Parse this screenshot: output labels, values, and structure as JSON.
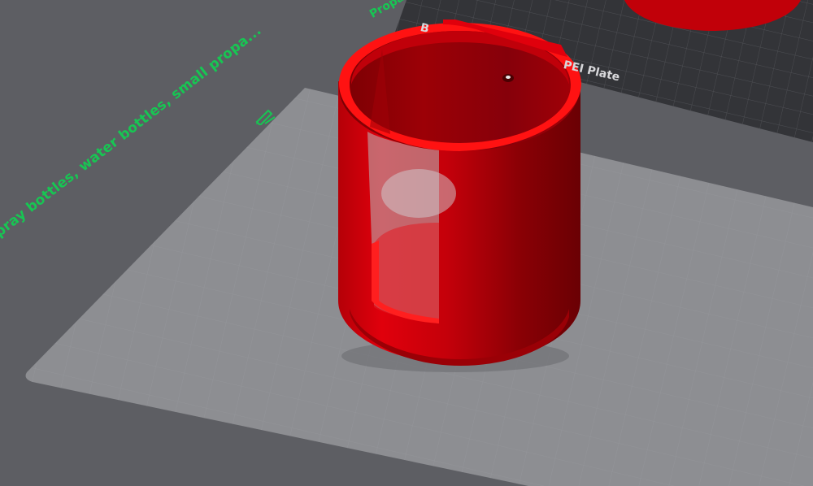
{
  "viewport": {
    "plate_left_label": "Spray bottles, water bottles, small propa...",
    "plate_top_label": "Propa",
    "plate_name": "PEI Plate",
    "plate_name_fragment": "B",
    "edit_icon": "pencil-icon"
  },
  "colors": {
    "background": "#5d5e63",
    "plate_surface": "#8e8f93",
    "pei_plate": "#3a3b3f",
    "model_red": "#c8000a",
    "label_green": "#17c653"
  }
}
